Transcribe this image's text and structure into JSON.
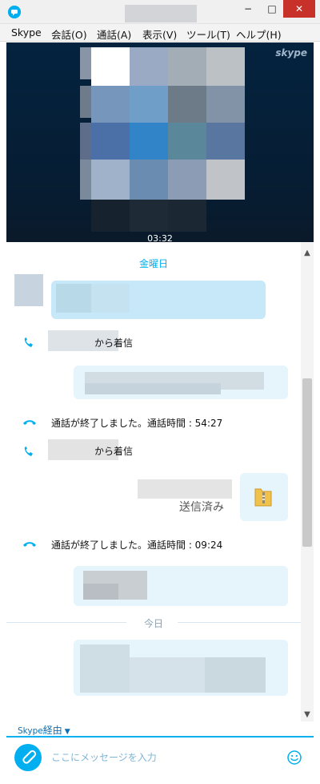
{
  "window": {
    "minimize_glyph": "−",
    "maximize_glyph": "□",
    "close_glyph": "✕"
  },
  "menu": [
    "Skype",
    "会話(O)",
    "通話(A)",
    "表示(V)",
    "ツール(T)",
    "ヘルプ(H)"
  ],
  "video": {
    "logo": "skype",
    "timer": "03:32"
  },
  "chat": {
    "day_header": "金曜日",
    "incoming_call_1": "から着信",
    "call_ended_1": "通話が終了しました。通話時間 : 54:27",
    "incoming_call_2": "から着信",
    "file_status": "送信済み",
    "call_ended_2": "通話が終了しました。通話時間 : 09:24",
    "today_divider": "今日"
  },
  "footer": {
    "via_skype": "Skype",
    "via_suffix": "経由",
    "message_placeholder": "ここにメッセージを入力"
  },
  "colors": {
    "accent": "#00aff0",
    "incoming_bubble": "#c7e8f9",
    "outgoing_bubble": "#e6f4fb",
    "close_button": "#c7312a"
  }
}
